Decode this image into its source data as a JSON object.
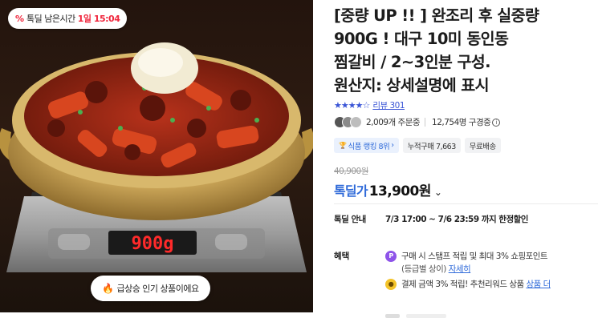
{
  "image": {
    "deal_timer": {
      "label": "톡딜 남은시간",
      "time": "1일 15:04"
    },
    "scale_display": "900g",
    "hot_badge": "급상승 인기 상품이에요"
  },
  "product": {
    "title": "[중량 UP !! ] 완조리 후 실중량\n900G ! 대구 10미 동인동\n찜갈비 / 2~3인분 구성.\n원산지: 상세설명에 표시",
    "rating": 4.5,
    "review_label": "리뷰 301",
    "orders": "2,009개 주문중",
    "viewers": "12,754명 구경중",
    "tags": [
      "식품 랭킹 8위",
      "누적구매 7,663",
      "무료배송"
    ],
    "original_price": "40,900원",
    "price_label": "톡딜가",
    "price": "13,900원",
    "deal_info": {
      "label": "톡딜 안내",
      "value": "7/3 17:00 ~ 7/6 23:59 까지 한정할인"
    },
    "benefit": {
      "label": "혜택",
      "items": [
        {
          "line1": "구매 시 스탬프 적립 및 최대 3% 쇼핑포인트",
          "line2": "(등급별 상이)",
          "link": "자세히"
        },
        {
          "line1": "결제 금액 3% 적립! 추천리워드 상품",
          "link": "상품 더"
        }
      ]
    }
  },
  "colors": {
    "deal_red": "#f0263c",
    "accent_blue": "#2f6ad9",
    "star_blue": "#3a55d6",
    "scale_led": "#ff2a2a"
  },
  "icons": [
    "percent-icon",
    "flame-icon",
    "star-icon",
    "info-icon",
    "trophy-icon",
    "chevron-down-icon",
    "point-p-icon",
    "coin-icon"
  ]
}
